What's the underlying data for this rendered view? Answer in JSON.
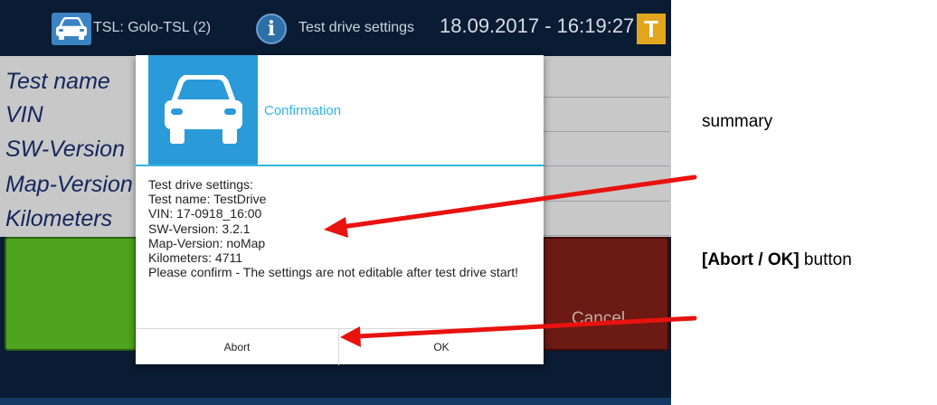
{
  "topbar": {
    "tsl_label": "TSL: Golo-TSL (2)",
    "settings_label": "Test drive settings",
    "datetime": "18.09.2017 - 16:19:27",
    "badge": "T"
  },
  "form": {
    "fields": [
      "Test name",
      "VIN",
      "SW-Version",
      "Map-Version",
      "Kilometers"
    ],
    "cancel_label": "Cancel"
  },
  "dialog": {
    "title": "Confirmation",
    "lines": [
      "Test drive settings:",
      "Test name: TestDrive",
      "VIN: 17-0918_16:00",
      "SW-Version: 3.2.1",
      "Map-Version: noMap",
      "Kilometers: 4711"
    ],
    "warning": "Please confirm - The settings are not editable after test drive start!",
    "abort_label": "Abort",
    "ok_label": "OK"
  },
  "annotations": {
    "summary": "summary",
    "buttons_bold": "[Abort / OK]",
    "buttons_rest": " button"
  },
  "colors": {
    "arrow": "#e8120f",
    "accent": "#33b5e5",
    "start_button": "#4ea31d",
    "cancel_button": "#6b1a14"
  },
  "icons": [
    "car-icon",
    "info-icon",
    "t-badge-icon"
  ]
}
